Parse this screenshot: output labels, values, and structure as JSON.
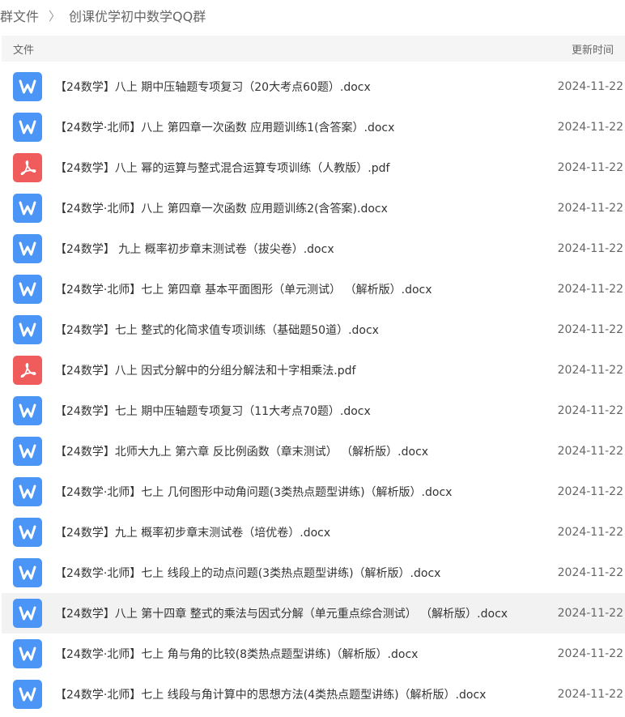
{
  "breadcrumb": {
    "root": "群文件",
    "separator": "〉",
    "current": "创课优学初中数学QQ群"
  },
  "columns": {
    "name": "文件",
    "time": "更新时间"
  },
  "colors": {
    "docx_icon": "#4a95f5",
    "pdf_icon": "#f05b5b",
    "header_bg": "#f5f5f5"
  },
  "files": [
    {
      "name": "【24数学】八上 期中压轴题专项复习（20大考点60题）.docx",
      "date": "2024-11-22",
      "icon": "word-icon"
    },
    {
      "name": "【24数学·北师】八上 第四章一次函数 应用题训练1(含答案）.docx",
      "date": "2024-11-22",
      "icon": "word-icon"
    },
    {
      "name": "【24数学】八上 幂的运算与整式混合运算专项训练（人教版）.pdf",
      "date": "2024-11-22",
      "icon": "pdf-icon"
    },
    {
      "name": "【24数学·北师】八上 第四章一次函数  应用题训练2(含答案).docx",
      "date": "2024-11-22",
      "icon": "word-icon"
    },
    {
      "name": "【24数学】 九上 概率初步章末测试卷（拔尖卷）.docx",
      "date": "2024-11-22",
      "icon": "word-icon"
    },
    {
      "name": "【24数学·北师】七上 第四章 基本平面图形（单元测试）  （解析版）.docx",
      "date": "2024-11-22",
      "icon": "word-icon"
    },
    {
      "name": "【24数学】七上 整式的化简求值专项训练（基础题50道）.docx",
      "date": "2024-11-22",
      "icon": "word-icon"
    },
    {
      "name": "【24数学】八上 因式分解中的分组分解法和十字相乘法.pdf",
      "date": "2024-11-22",
      "icon": "pdf-icon"
    },
    {
      "name": "【24数学】七上 期中压轴题专项复习（11大考点70题）.docx",
      "date": "2024-11-22",
      "icon": "word-icon"
    },
    {
      "name": "【24数学】北师大九上 第六章 反比例函数（章末测试）  （解析版）.docx",
      "date": "2024-11-22",
      "icon": "word-icon"
    },
    {
      "name": "【24数学·北师】七上 几何图形中动角问题(3类热点题型讲练)（解析版）.docx",
      "date": "2024-11-22",
      "icon": "word-icon"
    },
    {
      "name": "【24数学】九上 概率初步章末测试卷（培优卷）.docx",
      "date": "2024-11-22",
      "icon": "word-icon"
    },
    {
      "name": "【24数学·北师】七上 线段上的动点问题(3类热点题型讲练)（解析版）.docx",
      "date": "2024-11-22",
      "icon": "word-icon"
    },
    {
      "name": "【24数学】八上 第十四章 整式的乘法与因式分解（单元重点综合测试）  （解析版）.docx",
      "date": "2024-11-22",
      "icon": "word-icon"
    },
    {
      "name": "【24数学·北师】七上 角与角的比较(8类热点题型讲练)（解析版）.docx",
      "date": "2024-11-22",
      "icon": "word-icon"
    },
    {
      "name": "【24数学·北师】七上 线段与角计算中的思想方法(4类热点题型讲练)（解析版）.docx",
      "date": "2024-11-22",
      "icon": "word-icon"
    }
  ]
}
